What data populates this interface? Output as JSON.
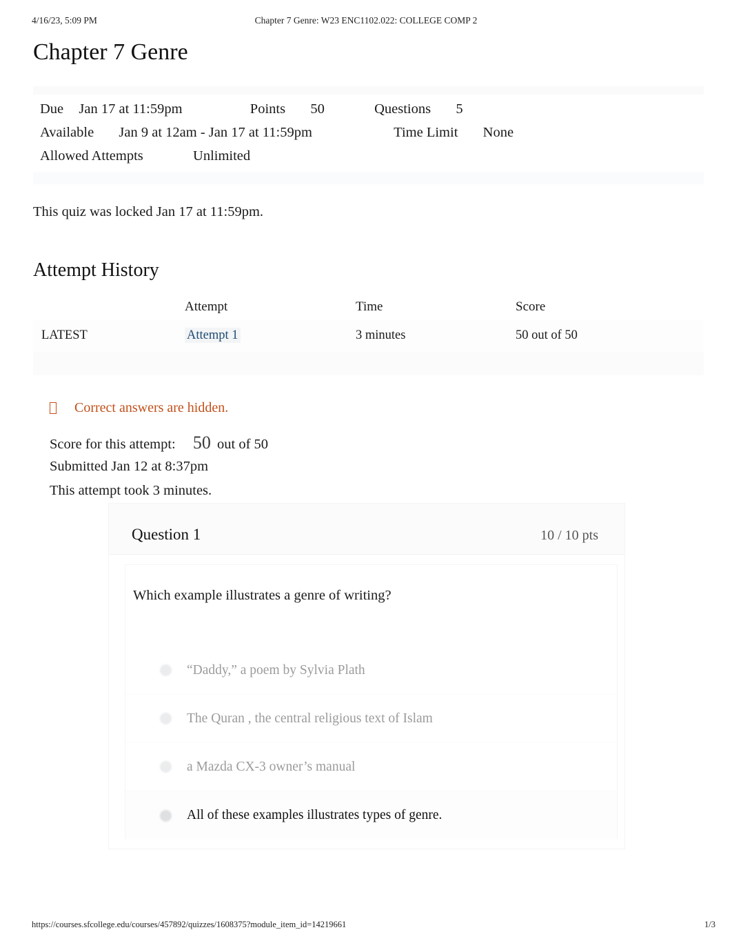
{
  "print_header": {
    "date": "4/16/23, 5:09 PM",
    "title": "Chapter 7 Genre: W23 ENC1102.022: COLLEGE COMP 2"
  },
  "page_title": "Chapter 7 Genre",
  "quiz_info": {
    "due_label": "Due",
    "due_value": "Jan 17 at 11:59pm",
    "points_label": "Points",
    "points_value": "50",
    "questions_label": "Questions",
    "questions_value": "5",
    "available_label": "Available",
    "available_value": "Jan 9 at 12am - Jan 17 at 11:59pm",
    "time_limit_label": "Time Limit",
    "time_limit_value": "None",
    "allowed_attempts_label": "Allowed Attempts",
    "allowed_attempts_value": "Unlimited"
  },
  "locked_notice": "This quiz was locked Jan 17 at 11:59pm.",
  "attempt_history": {
    "heading": "Attempt History",
    "columns": {
      "kept": "",
      "attempt": "Attempt",
      "time": "Time",
      "score": "Score"
    },
    "rows": [
      {
        "kept": "LATEST",
        "attempt": "Attempt 1",
        "time": "3 minutes",
        "score": "50 out of 50"
      }
    ]
  },
  "answers_hidden_note": {
    "icon": "eye-slash-icon",
    "text": "Correct answers are hidden.",
    "color": "#c2501b"
  },
  "score_summary": {
    "score_label": "Score for this attempt:",
    "score_value": "50",
    "score_out_of": "out of 50",
    "submitted": "Submitted Jan 12 at 8:37pm",
    "duration": "This attempt took 3 minutes."
  },
  "question": {
    "name": "Question 1",
    "points": "10 / 10 pts",
    "text": "Which example illustrates a genre of writing?",
    "answers": [
      {
        "text": "“Daddy,” a poem by Sylvia Plath",
        "selected": false
      },
      {
        "text": "The Quran , the central religious text of Islam",
        "selected": false
      },
      {
        "text": "a Mazda CX-3 owner’s manual",
        "selected": false
      },
      {
        "text": "All of these examples illustrates types of genre.",
        "selected": true
      }
    ]
  },
  "print_footer": {
    "url": "https://courses.sfcollege.edu/courses/457892/quizzes/1608375?module_item_id=14219661",
    "page": "1/3"
  }
}
